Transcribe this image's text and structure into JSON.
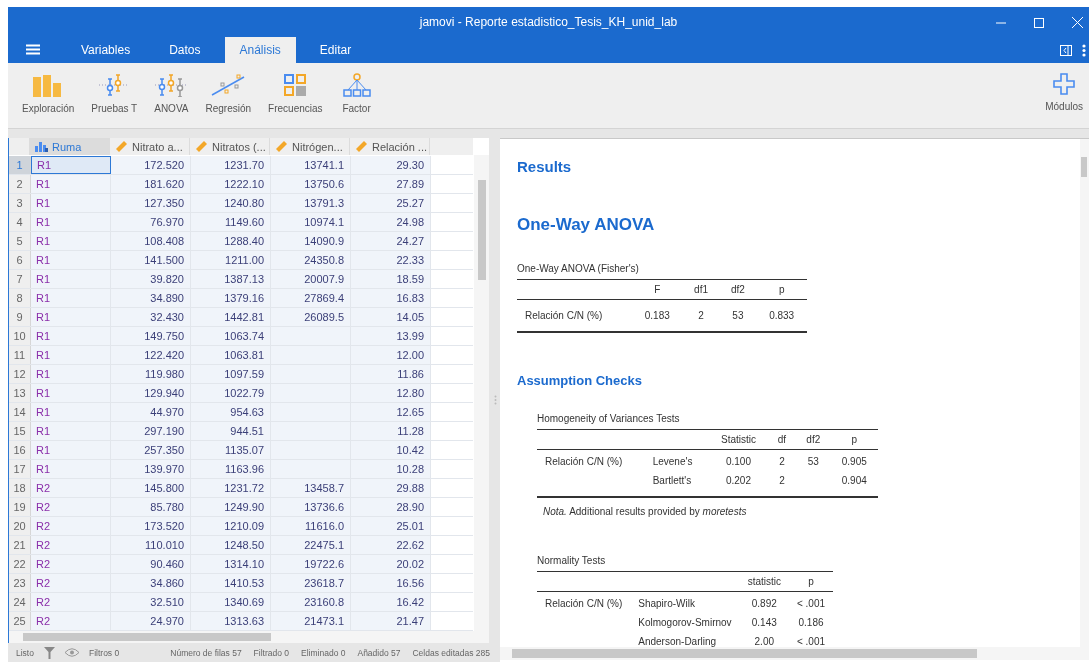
{
  "window": {
    "title": "jamovi - Reporte estadistico_Tesis_KH_unid_lab"
  },
  "tabs": [
    {
      "label": "Variables",
      "selected": false
    },
    {
      "label": "Datos",
      "selected": false
    },
    {
      "label": "Análisis",
      "selected": true
    },
    {
      "label": "Editar",
      "selected": false
    }
  ],
  "ribbon": [
    {
      "label": "Exploración",
      "kind": "exploration"
    },
    {
      "label": "Pruebas T",
      "kind": "ttest"
    },
    {
      "label": "ANOVA",
      "kind": "anova"
    },
    {
      "label": "Regresión",
      "kind": "regression"
    },
    {
      "label": "Frecuencias",
      "kind": "frequencies"
    },
    {
      "label": "Factor",
      "kind": "factor"
    }
  ],
  "modules": {
    "label": "Módulos"
  },
  "table": {
    "columns": [
      {
        "label": "Ruma",
        "kind": "nominal",
        "selected": true
      },
      {
        "label": "Nitrato a...",
        "kind": "continuous",
        "selected": false
      },
      {
        "label": "Nitratos (...",
        "kind": "continuous",
        "selected": false
      },
      {
        "label": "Nitrógen...",
        "kind": "continuous",
        "selected": false
      },
      {
        "label": "Relación ...",
        "kind": "continuous",
        "selected": false
      }
    ],
    "rows": [
      {
        "n": "1",
        "selected": true,
        "cells": [
          "R1",
          "172.520",
          "1231.70",
          "13741.1",
          "29.30"
        ]
      },
      {
        "n": "2",
        "selected": false,
        "cells": [
          "R1",
          "181.620",
          "1222.10",
          "13750.6",
          "27.89"
        ]
      },
      {
        "n": "3",
        "selected": false,
        "cells": [
          "R1",
          "127.350",
          "1240.80",
          "13791.3",
          "25.27"
        ]
      },
      {
        "n": "4",
        "selected": false,
        "cells": [
          "R1",
          "76.970",
          "1149.60",
          "10974.1",
          "24.98"
        ]
      },
      {
        "n": "5",
        "selected": false,
        "cells": [
          "R1",
          "108.408",
          "1288.40",
          "14090.9",
          "24.27"
        ]
      },
      {
        "n": "6",
        "selected": false,
        "cells": [
          "R1",
          "141.500",
          "1211.00",
          "24350.8",
          "22.33"
        ]
      },
      {
        "n": "7",
        "selected": false,
        "cells": [
          "R1",
          "39.820",
          "1387.13",
          "20007.9",
          "18.59"
        ]
      },
      {
        "n": "8",
        "selected": false,
        "cells": [
          "R1",
          "34.890",
          "1379.16",
          "27869.4",
          "16.83"
        ]
      },
      {
        "n": "9",
        "selected": false,
        "cells": [
          "R1",
          "32.430",
          "1442.81",
          "26089.5",
          "14.05"
        ]
      },
      {
        "n": "10",
        "selected": false,
        "cells": [
          "R1",
          "149.750",
          "1063.74",
          null,
          "13.99"
        ]
      },
      {
        "n": "11",
        "selected": false,
        "cells": [
          "R1",
          "122.420",
          "1063.81",
          null,
          "12.00"
        ]
      },
      {
        "n": "12",
        "selected": false,
        "cells": [
          "R1",
          "119.980",
          "1097.59",
          null,
          "11.86"
        ]
      },
      {
        "n": "13",
        "selected": false,
        "cells": [
          "R1",
          "129.940",
          "1022.79",
          null,
          "12.80"
        ]
      },
      {
        "n": "14",
        "selected": false,
        "cells": [
          "R1",
          "44.970",
          "954.63",
          null,
          "12.65"
        ]
      },
      {
        "n": "15",
        "selected": false,
        "cells": [
          "R1",
          "297.190",
          "944.51",
          null,
          "11.28"
        ]
      },
      {
        "n": "16",
        "selected": false,
        "cells": [
          "R1",
          "257.350",
          "1135.07",
          null,
          "10.42"
        ]
      },
      {
        "n": "17",
        "selected": false,
        "cells": [
          "R1",
          "139.970",
          "1163.96",
          null,
          "10.28"
        ]
      },
      {
        "n": "18",
        "selected": false,
        "cells": [
          "R2",
          "145.800",
          "1231.72",
          "13458.7",
          "29.88"
        ]
      },
      {
        "n": "19",
        "selected": false,
        "cells": [
          "R2",
          "85.780",
          "1249.90",
          "13736.6",
          "28.90"
        ]
      },
      {
        "n": "20",
        "selected": false,
        "cells": [
          "R2",
          "173.520",
          "1210.09",
          "11616.0",
          "25.01"
        ]
      },
      {
        "n": "21",
        "selected": false,
        "cells": [
          "R2",
          "110.010",
          "1248.50",
          "22475.1",
          "22.62"
        ]
      },
      {
        "n": "22",
        "selected": false,
        "cells": [
          "R2",
          "90.460",
          "1314.10",
          "19722.6",
          "20.02"
        ]
      },
      {
        "n": "23",
        "selected": false,
        "cells": [
          "R2",
          "34.860",
          "1410.53",
          "23618.7",
          "16.56"
        ]
      },
      {
        "n": "24",
        "selected": false,
        "cells": [
          "R2",
          "32.510",
          "1340.69",
          "23160.8",
          "16.42"
        ]
      },
      {
        "n": "25",
        "selected": false,
        "cells": [
          "R2",
          "24.970",
          "1313.63",
          "21473.1",
          "21.47"
        ]
      }
    ]
  },
  "status_bar": {
    "ready": "Listo",
    "filters": "Filtros 0",
    "items": [
      "Número de filas 57",
      "Filtrado 0",
      "Eliminado 0",
      "Añadido 57",
      "Celdas editadas 285"
    ]
  },
  "results": {
    "heading": "Results",
    "analysis_title": "One-Way ANOVA",
    "anova_table": {
      "title": "One-Way ANOVA (Fisher's)",
      "columns": [
        "",
        "F",
        "df1",
        "df2",
        "p"
      ],
      "rows": [
        [
          "Relación C/N (%)",
          "0.183",
          "2",
          "53",
          "0.833"
        ]
      ]
    },
    "assumptions_heading": "Assumption Checks",
    "homogeneity_table": {
      "title": "Homogeneity of Variances Tests",
      "columns": [
        "",
        "",
        "Statistic",
        "df",
        "df2",
        "p"
      ],
      "rows": [
        [
          "Relación C/N (%)",
          "Levene's",
          "0.100",
          "2",
          "53",
          "0.905"
        ],
        [
          "",
          "Bartlett's",
          "0.202",
          "2",
          "",
          "0.904"
        ]
      ],
      "note": "*Nota.* Additional results provided by *moretests*"
    },
    "normality_table": {
      "title": "Normality Tests",
      "columns": [
        "",
        "",
        "statistic",
        "p"
      ],
      "rows": [
        [
          "Relación C/N (%)",
          "Shapiro-Wilk",
          "0.892",
          "< .001"
        ],
        [
          "",
          "Kolmogorov-Smirnov",
          "0.143",
          "0.186"
        ],
        [
          "",
          "Anderson-Darling",
          "2.00",
          "< .001"
        ]
      ]
    }
  }
}
